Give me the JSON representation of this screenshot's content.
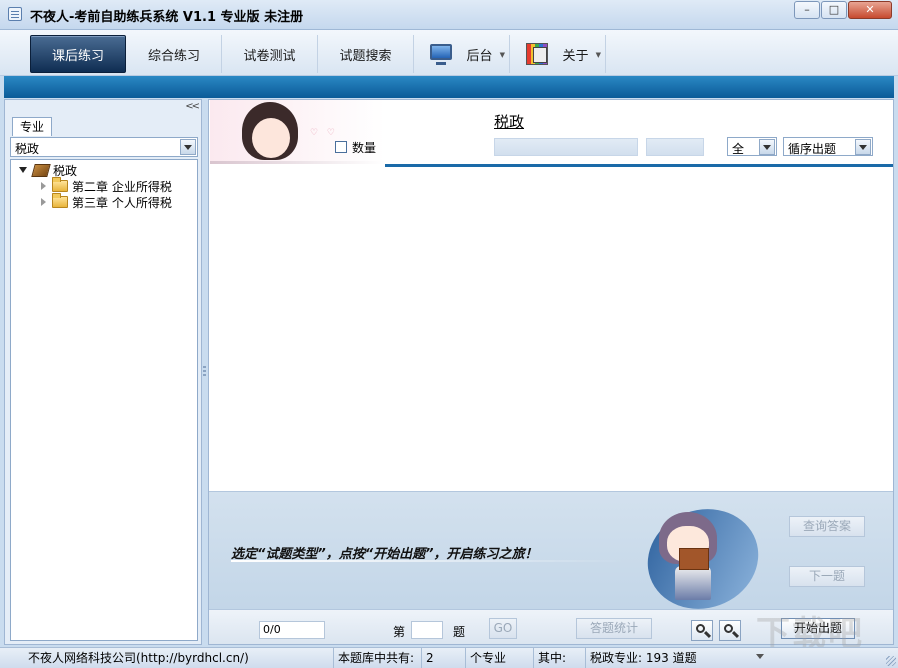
{
  "window": {
    "title": "不夜人-考前自助练兵系统 V1.1  专业版      未注册",
    "minimize_glyph": "–",
    "maximize_glyph": "□",
    "close_glyph": "✕"
  },
  "toolbar": {
    "tabs": [
      {
        "label": "课后练习",
        "active": true
      },
      {
        "label": "综合练习"
      },
      {
        "label": "试卷测试"
      },
      {
        "label": "试题搜索"
      },
      {
        "label": "后台",
        "icon": "monitor-icon"
      },
      {
        "label": "关于",
        "icon": "about-icon"
      }
    ]
  },
  "sidebar": {
    "collapse_glyph": "<<",
    "tab_label": "专业",
    "selected_major": "税政",
    "tree": {
      "root": {
        "label": "税政",
        "icon": "book-icon"
      },
      "children": [
        {
          "label": "第二章  企业所得税",
          "icon": "folder-icon"
        },
        {
          "label": "第三章  个人所得税",
          "icon": "folder-icon"
        }
      ]
    }
  },
  "main": {
    "subject_title": "税政",
    "quantity_label": "数量",
    "quantity_checked": false,
    "range_select": "全",
    "order_select": "循序出题",
    "hint": "选定“试题类型”，点按“开始出题”，开启练习之旅！",
    "query_answer_label": "查询答案",
    "next_question_label": "下一题"
  },
  "footer": {
    "progress": "0/0",
    "question_prefix": "第",
    "question_number": "",
    "question_suffix": "题",
    "go_label": "GO",
    "stats_label": "答题统计",
    "start_label": "开始出题"
  },
  "statusbar": {
    "company": "不夜人网络科技公司(http://byrdhcl.cn/)",
    "total_label": "本题库中共有:",
    "total_count": "2",
    "unit_label": "个专业",
    "among_label": "其中:",
    "detail": "税政专业: 193 道题"
  },
  "colors": {
    "accent_blue": "#0b5b98",
    "active_tab": "#0f2d52"
  }
}
